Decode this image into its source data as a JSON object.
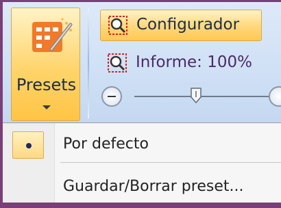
{
  "ribbon": {
    "presets_label": "Presets",
    "configurador_label": "Configurador",
    "informe_label": "Informe: 100%",
    "zoom": {
      "level_percent": 100
    }
  },
  "menu": {
    "items": [
      {
        "label": "Por defecto",
        "selected": true
      },
      {
        "label": "Guardar/Borrar preset...",
        "selected": false
      }
    ]
  },
  "colors": {
    "frame": "#7a3f78",
    "highlight": "#ffd46b",
    "ribbon_bg": "#d6e4f6"
  },
  "icons": [
    "presets-grid-icon",
    "magnifier-icon",
    "zoom-out-icon",
    "zoom-in-icon",
    "slider-thumb-icon",
    "radio-dot-icon",
    "dropdown-arrow-icon"
  ]
}
